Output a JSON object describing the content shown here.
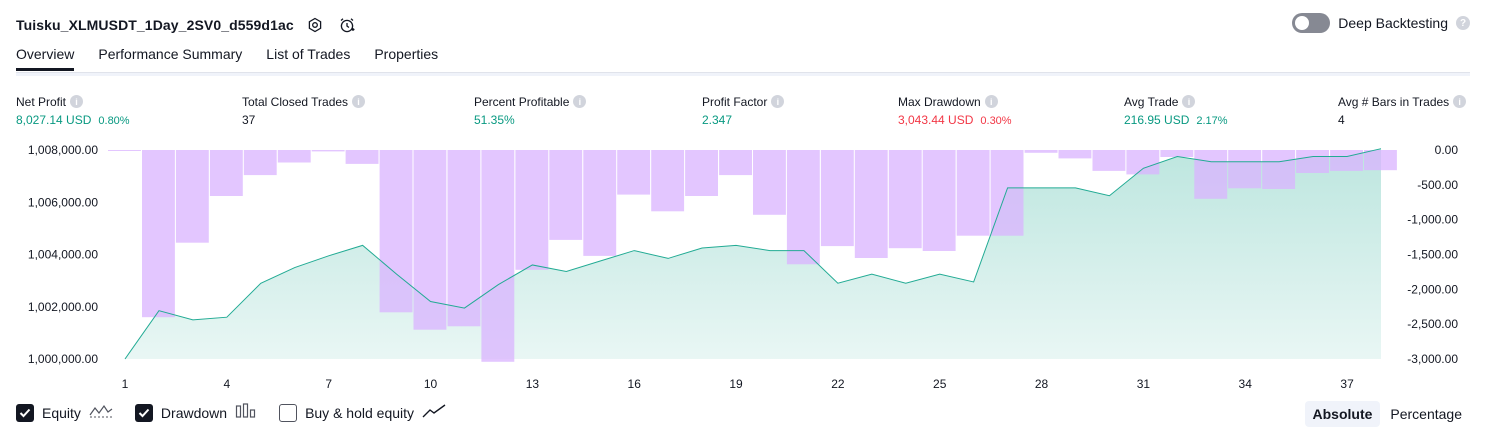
{
  "header": {
    "title": "Tuisku_XLMUSDT_1Day_2SV0_d559d1ac",
    "deep_backtesting_label": "Deep Backtesting",
    "help_glyph": "?",
    "icons": [
      "settings-icon",
      "alert-clock-icon"
    ]
  },
  "tabs": [
    {
      "label": "Overview",
      "active": true
    },
    {
      "label": "Performance Summary",
      "active": false
    },
    {
      "label": "List of Trades",
      "active": false
    },
    {
      "label": "Properties",
      "active": false
    }
  ],
  "metrics": [
    {
      "label": "Net Profit",
      "value": "8,027.14 USD",
      "pct": "0.80%",
      "color": "#089981"
    },
    {
      "label": "Total Closed Trades",
      "value": "37",
      "pct": "",
      "color": "#131722"
    },
    {
      "label": "Percent Profitable",
      "value": "51.35%",
      "pct": "",
      "color": "#089981"
    },
    {
      "label": "Profit Factor",
      "value": "2.347",
      "pct": "",
      "color": "#089981"
    },
    {
      "label": "Max Drawdown",
      "value": "3,043.44 USD",
      "pct": "0.30%",
      "color": "#f23645"
    },
    {
      "label": "Avg Trade",
      "value": "216.95 USD",
      "pct": "2.17%",
      "color": "#089981"
    },
    {
      "label": "Avg # Bars in Trades",
      "value": "4",
      "pct": "",
      "color": "#131722"
    }
  ],
  "info_glyph": "i",
  "chart_data": {
    "type": "line",
    "x": [
      1,
      2,
      3,
      4,
      5,
      6,
      7,
      8,
      9,
      10,
      11,
      12,
      13,
      14,
      15,
      16,
      17,
      18,
      19,
      20,
      21,
      22,
      23,
      24,
      25,
      26,
      27,
      28,
      29,
      30,
      31,
      32,
      33,
      34,
      35,
      36,
      37,
      38
    ],
    "x_tick_labels": [
      "1",
      "4",
      "7",
      "10",
      "13",
      "16",
      "19",
      "22",
      "25",
      "28",
      "31",
      "34",
      "37"
    ],
    "series": [
      {
        "name": "Equity",
        "type": "area",
        "axis": "left",
        "color": "#22ab94",
        "values": [
          1000000,
          1001850,
          1001500,
          1001600,
          1002900,
          1003500,
          1003950,
          1004350,
          1003250,
          1002200,
          1001950,
          1002850,
          1003600,
          1003350,
          1003750,
          1004150,
          1003850,
          1004250,
          1004350,
          1004150,
          1004150,
          1002900,
          1003250,
          1002900,
          1003250,
          1002950,
          1006550,
          1006550,
          1006550,
          1006250,
          1007300,
          1007750,
          1007550,
          1007550,
          1007550,
          1007750,
          1007750,
          1008050
        ]
      },
      {
        "name": "Drawdown",
        "type": "bar",
        "axis": "right",
        "color": "#d9b3ff",
        "values": [
          0,
          -2400,
          -1330,
          -660,
          -360,
          -180,
          -20,
          -200,
          -2330,
          -2580,
          -2530,
          -3040,
          -1720,
          -1290,
          -1520,
          -640,
          -880,
          -660,
          -360,
          -930,
          -1640,
          -1380,
          -1550,
          -1410,
          -1450,
          -1230,
          -1230,
          -40,
          -120,
          -300,
          -350,
          -100,
          -700,
          -550,
          -560,
          -330,
          -300,
          -290
        ]
      }
    ],
    "y_left": {
      "min": 1000000,
      "max": 1008000,
      "ticks": [
        "1,008,000.00",
        "1,006,000.00",
        "1,004,000.00",
        "1,002,000.00",
        "1,000,000.00"
      ]
    },
    "y_right": {
      "min": -3000,
      "max": 0,
      "ticks": [
        "0.00",
        "-500.00",
        "-1,000.00",
        "-1,500.00",
        "-2,000.00",
        "-2,500.00",
        "-3,000.00"
      ]
    },
    "grid": false
  },
  "legend": [
    {
      "label": "Equity",
      "checked": true,
      "icon": "equity-line-icon"
    },
    {
      "label": "Drawdown",
      "checked": true,
      "icon": "drawdown-bars-icon"
    },
    {
      "label": "Buy & hold equity",
      "checked": false,
      "icon": "buy-hold-line-icon"
    }
  ],
  "modes": [
    {
      "label": "Absolute",
      "active": true
    },
    {
      "label": "Percentage",
      "active": false
    }
  ]
}
